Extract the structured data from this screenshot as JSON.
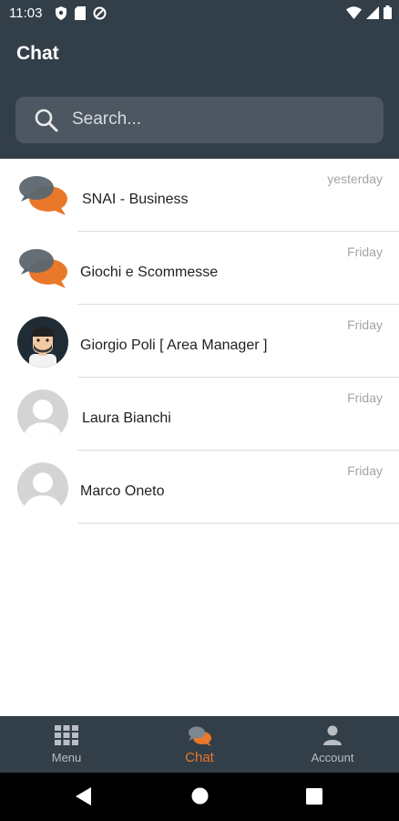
{
  "status_bar": {
    "time": "11:03"
  },
  "header": {
    "title": "Chat"
  },
  "search": {
    "placeholder": "Search..."
  },
  "chats": [
    {
      "name": "SNAI - Business",
      "time": "yesterday",
      "avatar": "chat-bubbles-icon"
    },
    {
      "name": "Giochi e Scommesse",
      "time": "Friday",
      "avatar": "chat-bubbles-icon"
    },
    {
      "name": "Giorgio Poli [ Area Manager ]",
      "time": "Friday",
      "avatar": "avatar-illustration"
    },
    {
      "name": "Laura Bianchi",
      "time": "Friday",
      "avatar": "default-user-icon"
    },
    {
      "name": "Marco Oneto",
      "time": "Friday",
      "avatar": "default-user-icon"
    }
  ],
  "bottom_nav": {
    "items": [
      {
        "label": "Menu",
        "icon": "grid-icon",
        "active": false
      },
      {
        "label": "Chat",
        "icon": "chat-bubbles-icon",
        "active": true
      },
      {
        "label": "Account",
        "icon": "person-icon",
        "active": false
      }
    ]
  },
  "colors": {
    "header_bg": "#323e48",
    "accent": "#e9782a",
    "bubble_gray": "#5b6670"
  }
}
